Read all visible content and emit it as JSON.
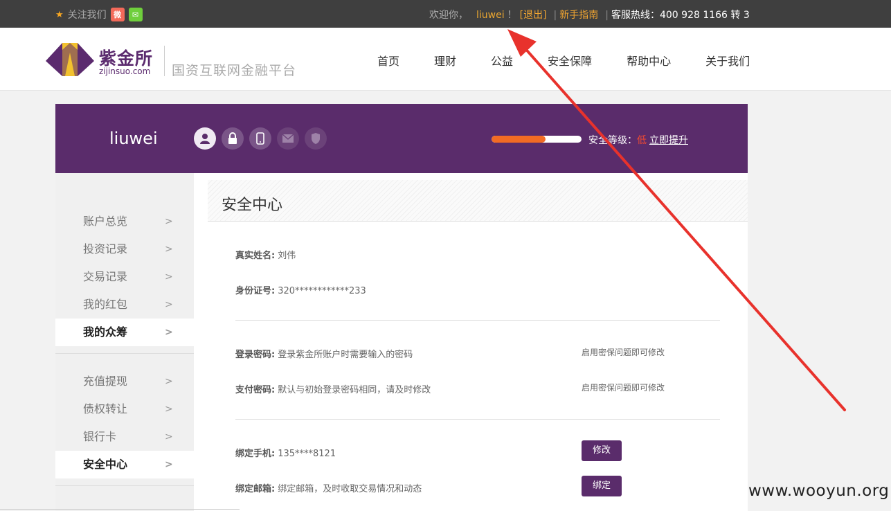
{
  "topbar": {
    "follow_label": "关注我们",
    "star_icon": "star-icon",
    "weibo_icon": "weibo-icon",
    "wechat_icon": "wechat-icon",
    "welcome": "欢迎你，",
    "username": "liuwei",
    "exclaim": "！",
    "logout": "[退出]",
    "guide": "新手指南",
    "hotline": "客服热线：400 928 1166 转 3"
  },
  "header": {
    "logo_cn": "紫金所",
    "logo_en": "zijinsuo.com",
    "slogan": "国资互联网金融平台",
    "nav": [
      "首页",
      "理财",
      "公益",
      "安全保障",
      "帮助中心",
      "关于我们"
    ]
  },
  "banner": {
    "username": "liuwei",
    "icons": [
      "user-icon",
      "lock-icon",
      "phone-icon",
      "mail-icon",
      "shield-icon"
    ],
    "security_progress": 0.6,
    "security_label": "安全等级：",
    "security_level": "低",
    "upgrade_link": "立即提升"
  },
  "sidebar": {
    "group1": [
      "账户总览",
      "投资记录",
      "交易记录",
      "我的红包",
      "我的众筹"
    ],
    "group2": [
      "充值提现",
      "债权转让",
      "银行卡",
      "安全中心"
    ],
    "selected_group1": "我的众筹",
    "selected_group2": "安全中心"
  },
  "main": {
    "title": "安全中心",
    "real_name_label": "真实姓名:",
    "real_name_value": "刘伟",
    "id_label": "身份证号:",
    "id_value": "320************233",
    "login_pwd_label": "登录密码:",
    "login_pwd_desc": "登录紫金所账户时需要输入的密码",
    "login_pwd_hint": "启用密保问题即可修改",
    "pay_pwd_label": "支付密码:",
    "pay_pwd_desc": "默认与初始登录密码相同，请及时修改",
    "pay_pwd_hint": "启用密保问题即可修改",
    "phone_label": "绑定手机:",
    "phone_value": "135****8121",
    "phone_button": "修改",
    "email_label": "绑定邮箱:",
    "email_desc": "绑定邮箱，及时收取交易情况和动态",
    "email_button": "绑定"
  },
  "watermark": "www.wooyun.org",
  "colors": {
    "brand_purple": "#5a2c6b",
    "accent_orange": "#f26b24",
    "annotation_red": "#e8322c"
  }
}
